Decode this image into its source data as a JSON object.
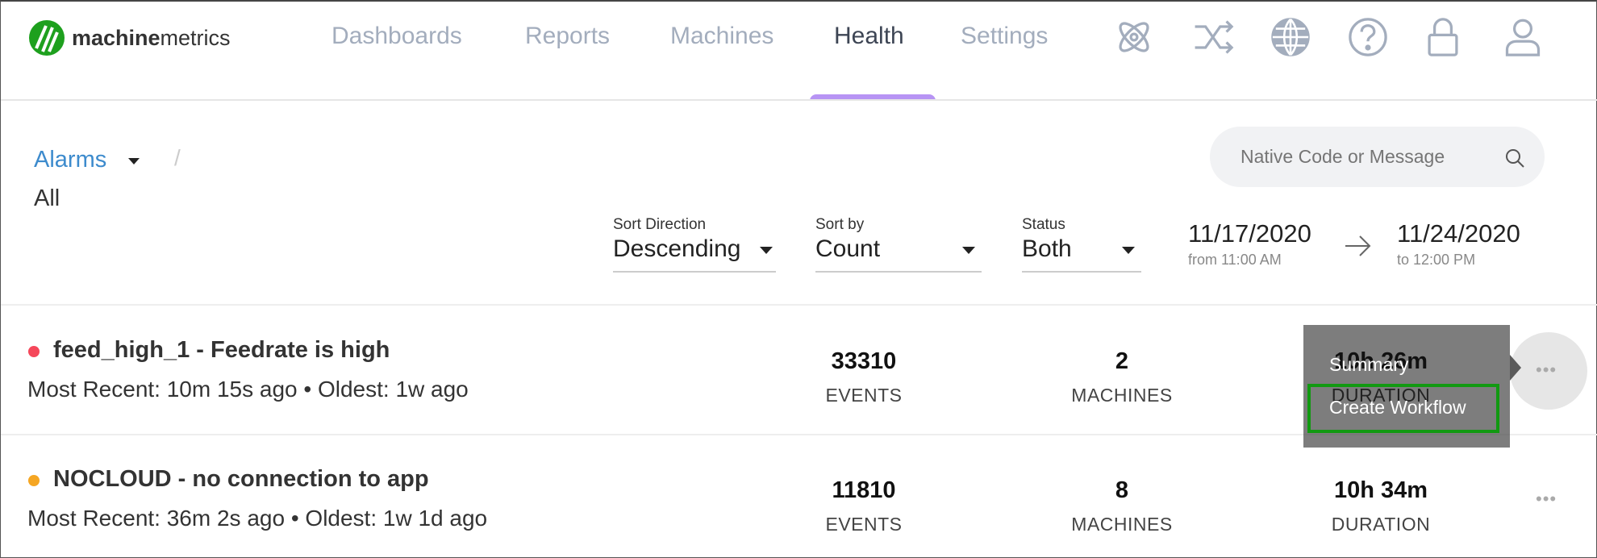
{
  "brand": {
    "bold": "machine",
    "light": "metrics",
    "color": "#1ea01e"
  },
  "nav": [
    {
      "label": "Dashboards"
    },
    {
      "label": "Reports"
    },
    {
      "label": "Machines"
    },
    {
      "label": "Health",
      "active": true
    },
    {
      "label": "Settings"
    }
  ],
  "nav_icons": [
    "atom-icon",
    "shuffle-icon",
    "globe-icon",
    "help-icon",
    "lock-icon",
    "user-icon"
  ],
  "accent": "#b794f4",
  "breadcrumb": {
    "root": "Alarms",
    "separator": "/",
    "current": "All"
  },
  "search": {
    "placeholder": "Native Code or Message"
  },
  "filters": {
    "sort_direction": {
      "label": "Sort Direction",
      "value": "Descending"
    },
    "sort_by": {
      "label": "Sort by",
      "value": "Count"
    },
    "status": {
      "label": "Status",
      "value": "Both"
    }
  },
  "date_range": {
    "from_date": "11/17/2020",
    "from_time": "from 11:00 AM",
    "to_date": "11/24/2020",
    "to_time": "to 12:00 PM"
  },
  "alarms": [
    {
      "title": "feed_high_1 - Feedrate is high",
      "subtitle": "Most Recent: 10m 15s ago • Oldest: 1w ago",
      "status_color": "#f5475a",
      "events": "33310",
      "events_label": "EVENTS",
      "machines": "2",
      "machines_label": "MACHINES",
      "duration": "10h 26m",
      "duration_label": "DURATION"
    },
    {
      "title": "NOCLOUD - no connection to app",
      "subtitle": "Most Recent: 36m 2s ago • Oldest: 1w 1d ago",
      "status_color": "#f5a623",
      "events": "11810",
      "events_label": "EVENTS",
      "machines": "8",
      "machines_label": "MACHINES",
      "duration": "10h 34m",
      "duration_label": "DURATION"
    }
  ],
  "row_menu": {
    "items": [
      "Summary",
      "Create Workflow"
    ],
    "highlighted": "Create Workflow",
    "highlight_color": "#119911"
  },
  "more_label": "•••"
}
